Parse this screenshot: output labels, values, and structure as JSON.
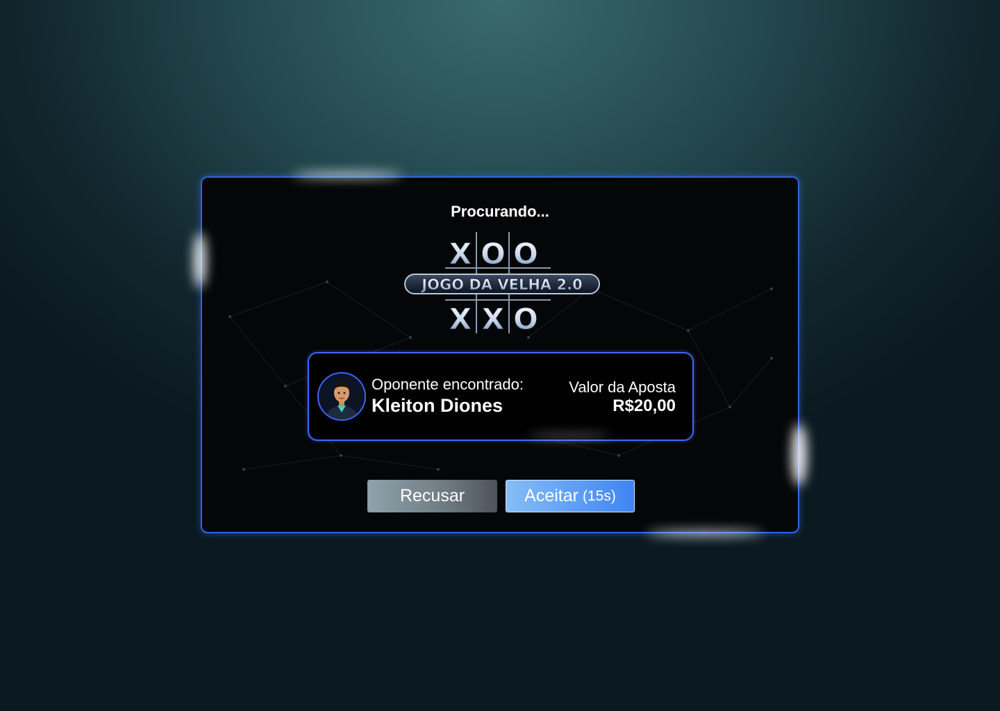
{
  "modal": {
    "title": "Procurando...",
    "logo": {
      "top_row": [
        "X",
        "O",
        "O"
      ],
      "banner_text": "JOGO DA VELHA 2.0",
      "bottom_row": [
        "X",
        "X",
        "O"
      ]
    },
    "opponent": {
      "label": "Oponente encontrado:",
      "name": "Kleiton Diones",
      "avatar_icon": "person-avatar-icon"
    },
    "bet": {
      "label": "Valor da Aposta",
      "value": "R$20,00"
    },
    "buttons": {
      "decline_label": "Recusar",
      "accept_label": "Aceitar",
      "accept_timer": "(15s)"
    }
  },
  "colors": {
    "border_accent": "#2e63e8",
    "accept_button": "#3f84f5",
    "decline_button": "#6f7b82"
  }
}
